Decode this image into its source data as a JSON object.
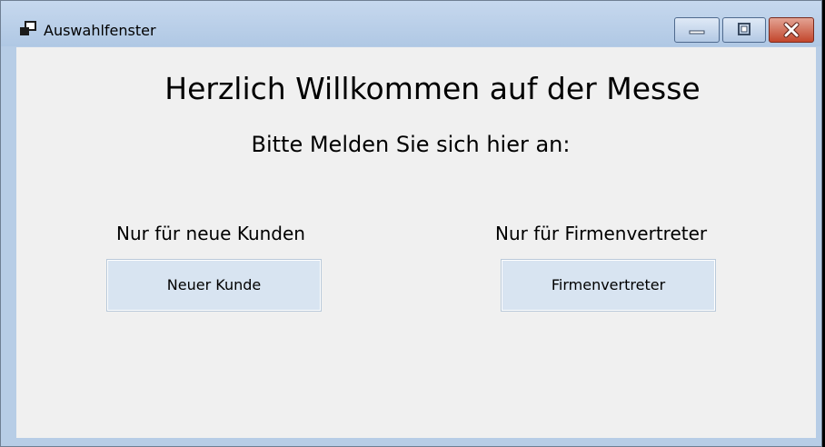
{
  "window": {
    "title": "Auswahlfenster",
    "controls": {
      "minimize": "minimize-icon",
      "maximize": "maximize-icon",
      "close": "close-icon"
    }
  },
  "main": {
    "heading": "Herzlich Willkommen auf der Messe",
    "subheading": "Bitte Melden Sie sich hier an:",
    "left": {
      "label": "Nur für neue Kunden",
      "button": "Neuer Kunde"
    },
    "right": {
      "label": "Nur für Firmenvertreter",
      "button": "Firmenvertreter"
    }
  },
  "colors": {
    "titlebar": "#b7cde6",
    "client": "#f0f0f0",
    "button": "#d8e4f1",
    "close": "#c3462c"
  }
}
